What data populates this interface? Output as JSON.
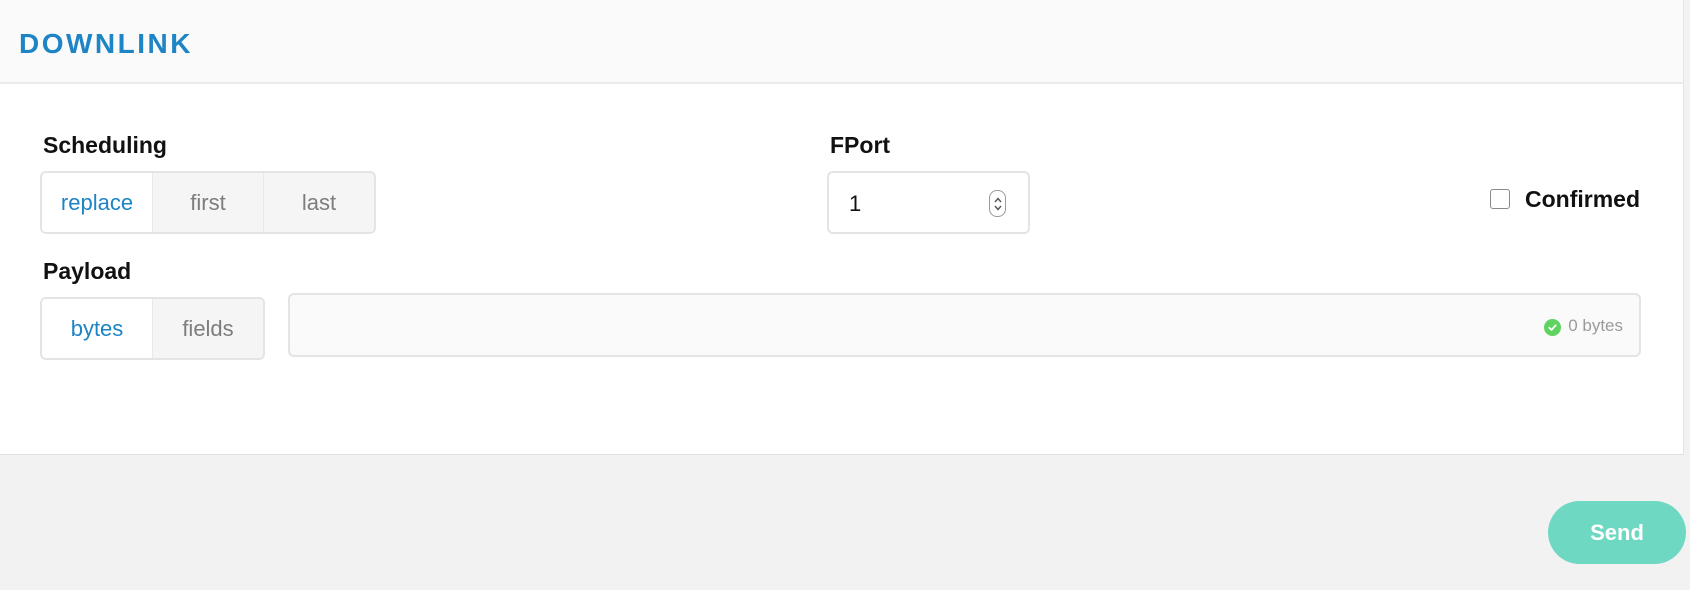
{
  "panel": {
    "title": "DOWNLINK"
  },
  "scheduling": {
    "label": "Scheduling",
    "options": [
      "replace",
      "first",
      "last"
    ],
    "selected": "replace"
  },
  "fport": {
    "label": "FPort",
    "value": "1"
  },
  "confirmed": {
    "label": "Confirmed",
    "checked": false
  },
  "payload": {
    "label": "Payload",
    "modes": [
      "bytes",
      "fields"
    ],
    "selected_mode": "bytes",
    "value": "",
    "byte_count": "0 bytes",
    "status_icon": "check-circle-icon"
  },
  "actions": {
    "send_label": "Send"
  },
  "colors": {
    "accent": "#1d84c6",
    "send_button": "#6fd8c2",
    "valid": "#5fd35f"
  }
}
